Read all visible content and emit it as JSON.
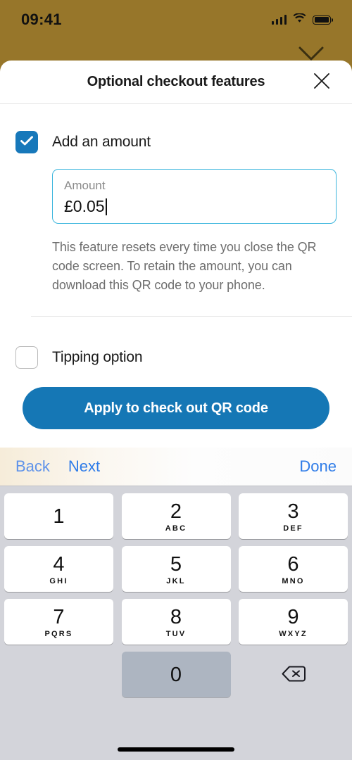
{
  "theme": {
    "background_gold": "#97762a",
    "accent_blue": "#1577b5",
    "checkbox_blue": "#1778ba",
    "input_focus_border": "#3cb6dd",
    "toolbar_link_blue": "#2f7ce8",
    "keyboard_background": "#d3d4da"
  },
  "status_bar": {
    "time": "09:41",
    "signal_icon": "cellular-bars-icon",
    "wifi_icon": "wifi-icon",
    "battery_icon": "battery-full-icon"
  },
  "background": {
    "chevron_icon": "chevron-down-icon"
  },
  "sheet": {
    "title": "Optional checkout features",
    "close_icon": "close-icon",
    "amount_option": {
      "label": "Add an amount",
      "checked": true,
      "checkbox_icon": "checkmark-icon"
    },
    "amount_field": {
      "label": "Amount",
      "placeholder": "Amount",
      "value": "£0.05",
      "focused": true
    },
    "helper_text": "This feature resets every time you close the QR code screen. To retain the amount, you can download this QR code to your phone.",
    "tipping_option": {
      "label": "Tipping option",
      "checked": false
    },
    "cta": {
      "label": "Apply to check out QR code"
    }
  },
  "keyboard": {
    "toolbar": {
      "back": "Back",
      "next": "Next",
      "done": "Done"
    },
    "keys": [
      {
        "digit": "1",
        "letters": ""
      },
      {
        "digit": "2",
        "letters": "ABC"
      },
      {
        "digit": "3",
        "letters": "DEF"
      },
      {
        "digit": "4",
        "letters": "GHI"
      },
      {
        "digit": "5",
        "letters": "JKL"
      },
      {
        "digit": "6",
        "letters": "MNO"
      },
      {
        "digit": "7",
        "letters": "PQRS"
      },
      {
        "digit": "8",
        "letters": "TUV"
      },
      {
        "digit": "9",
        "letters": "WXYZ"
      }
    ],
    "zero_key": {
      "digit": "0",
      "letters": "",
      "pressed": true
    },
    "delete_key": {
      "icon": "backspace-icon"
    }
  },
  "home_indicator": "home-indicator"
}
